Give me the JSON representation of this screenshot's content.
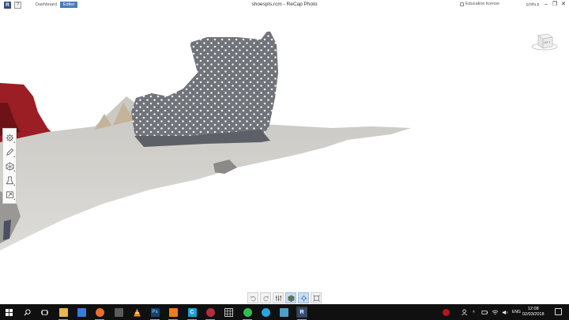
{
  "titlebar": {
    "logo_letter": "R",
    "help_label": "?",
    "tabs": [
      {
        "label": "Dashboard",
        "active": false
      },
      {
        "label": "Editor",
        "active": true
      }
    ],
    "window_title": "shoespls.rcm - ReCap Photo",
    "license_text": "Education license",
    "user_name": "g.bitu.p",
    "window_controls": [
      "minimize",
      "restore",
      "close"
    ]
  },
  "viewcube": {
    "face_label": "LEFT"
  },
  "tool_palette": {
    "tools": [
      {
        "name": "settings",
        "icon": "gear-icon"
      },
      {
        "name": "edit",
        "icon": "pencil-icon"
      },
      {
        "name": "mesh",
        "icon": "polygon-icon"
      },
      {
        "name": "analyze",
        "icon": "measure-icon"
      },
      {
        "name": "export",
        "icon": "export-icon"
      }
    ]
  },
  "bottom_toolbar": {
    "buttons": [
      {
        "name": "undo",
        "icon": "undo-icon",
        "active": false
      },
      {
        "name": "redo",
        "icon": "redo-icon",
        "active": false
      },
      {
        "name": "adjust",
        "icon": "sliders-icon",
        "active": false
      },
      {
        "name": "render-mode",
        "icon": "cube-icon",
        "active": true
      },
      {
        "name": "orbit",
        "icon": "orbit-icon",
        "active": true
      },
      {
        "name": "fit",
        "icon": "fit-icon",
        "active": false
      }
    ]
  },
  "taskbar": {
    "apps": [
      {
        "name": "file-explorer",
        "icon": "folder-icon",
        "color": "#e8b84a"
      },
      {
        "name": "store",
        "icon": "store-icon",
        "color": "#3a7ad8"
      },
      {
        "name": "firefox",
        "icon": "firefox-icon",
        "color": "#e8702a"
      },
      {
        "name": "calculator",
        "icon": "calculator-icon",
        "color": "#5b5b5b"
      },
      {
        "name": "vlc",
        "icon": "vlc-icon",
        "color": "#f08a16"
      },
      {
        "name": "photoshop",
        "icon": "photoshop-icon",
        "color": "#1f3f66",
        "text": "Ps"
      },
      {
        "name": "app-orange",
        "icon": "app-icon",
        "color": "#f07a1e"
      },
      {
        "name": "ccleaner",
        "icon": "ccleaner-icon",
        "color": "#1aa0d8",
        "text": "C"
      },
      {
        "name": "app-sphere",
        "icon": "sphere-icon",
        "color": "#b03040"
      },
      {
        "name": "calc-grid",
        "icon": "grid-icon",
        "color": "#dcdcdc"
      },
      {
        "name": "whatsapp",
        "icon": "whatsapp-icon",
        "color": "#2fbe4e"
      },
      {
        "name": "telegram",
        "icon": "telegram-icon",
        "color": "#2aa3de"
      },
      {
        "name": "app-box",
        "icon": "box-icon",
        "color": "#4aa0c8"
      },
      {
        "name": "recap-photo",
        "icon": "recap-icon",
        "color": "#2f4f7a",
        "text": "R"
      }
    ],
    "tray": {
      "input_language": "ENG",
      "time": "12:08",
      "date": "02/03/2018"
    }
  }
}
